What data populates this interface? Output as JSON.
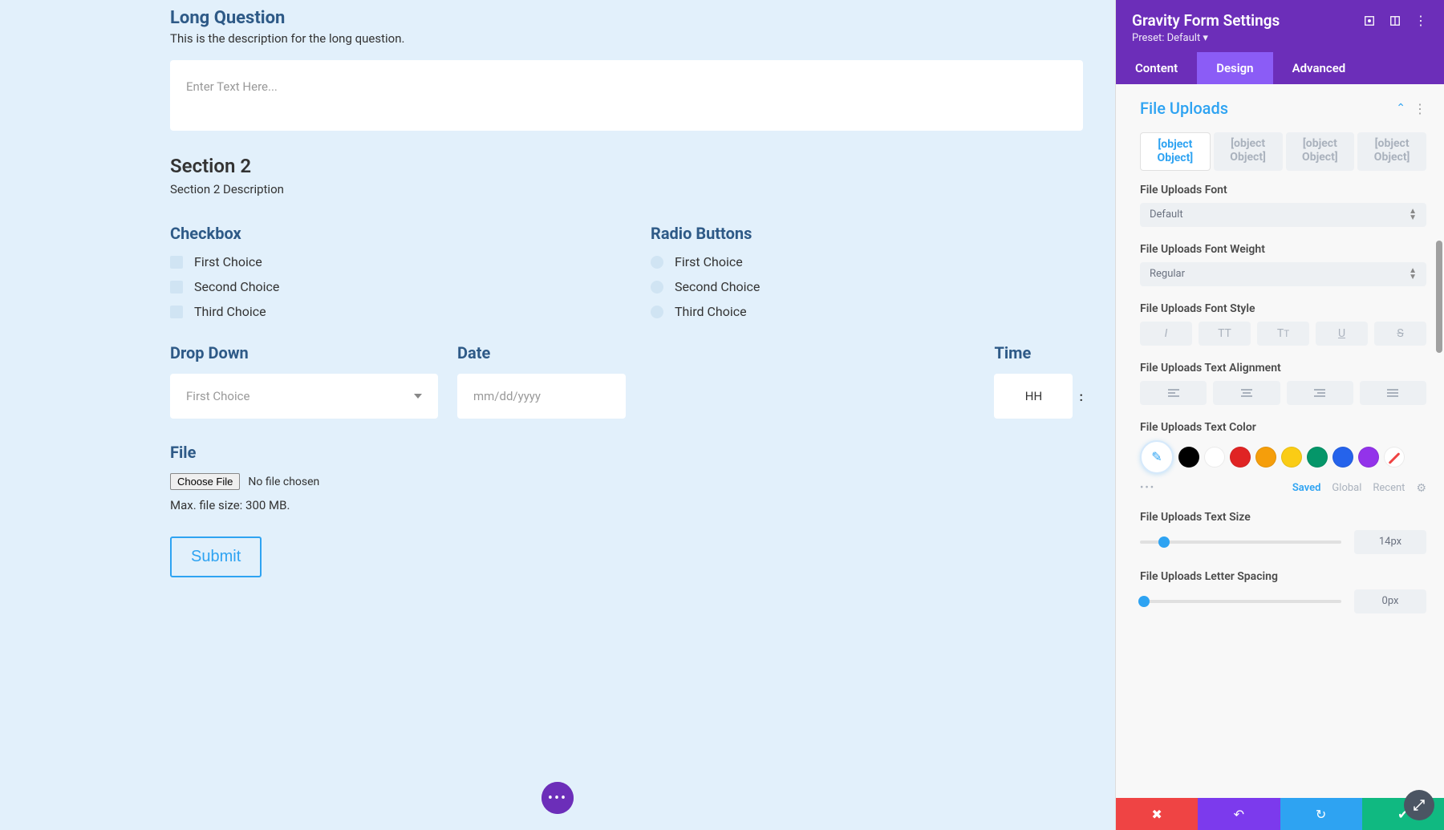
{
  "form": {
    "long_question": {
      "title": "Long Question",
      "description": "This is the description for the long question.",
      "placeholder": "Enter Text Here..."
    },
    "section2": {
      "title": "Section 2",
      "description": "Section 2 Description"
    },
    "checkbox": {
      "label": "Checkbox",
      "choices": [
        "First Choice",
        "Second Choice",
        "Third Choice"
      ]
    },
    "radio": {
      "label": "Radio Buttons",
      "choices": [
        "First Choice",
        "Second Choice",
        "Third Choice"
      ]
    },
    "dropdown": {
      "label": "Drop Down",
      "selected": "First Choice"
    },
    "date": {
      "label": "Date",
      "placeholder": "mm/dd/yyyy"
    },
    "time": {
      "label": "Time",
      "hh": "HH",
      "separator": ":"
    },
    "file": {
      "label": "File",
      "choose_btn": "Choose File",
      "no_file": "No file chosen",
      "max_size": "Max. file size: 300 MB."
    },
    "submit": "Submit"
  },
  "panel": {
    "title": "Gravity Form Settings",
    "preset": "Preset: Default ▾",
    "tabs": {
      "content": "Content",
      "design": "Design",
      "advanced": "Advanced"
    },
    "section_title": "File Uploads",
    "subtabs": [
      "[object Object]",
      "[object Object]",
      "[object Object]",
      "[object Object]"
    ],
    "font": {
      "label": "File Uploads Font",
      "value": "Default"
    },
    "font_weight": {
      "label": "File Uploads Font Weight",
      "value": "Regular"
    },
    "font_style": {
      "label": "File Uploads Font Style"
    },
    "text_align": {
      "label": "File Uploads Text Alignment"
    },
    "text_color": {
      "label": "File Uploads Text Color",
      "saved": "Saved",
      "global": "Global",
      "recent": "Recent",
      "swatches": [
        "#000000",
        "#ffffff",
        "#e02424",
        "#f59e0b",
        "#facc15",
        "#059669",
        "#2563eb",
        "#9333ea"
      ]
    },
    "text_size": {
      "label": "File Uploads Text Size",
      "value": "14px",
      "pct": 12
    },
    "letter_spacing": {
      "label": "File Uploads Letter Spacing",
      "value": "0px",
      "pct": 2
    }
  }
}
